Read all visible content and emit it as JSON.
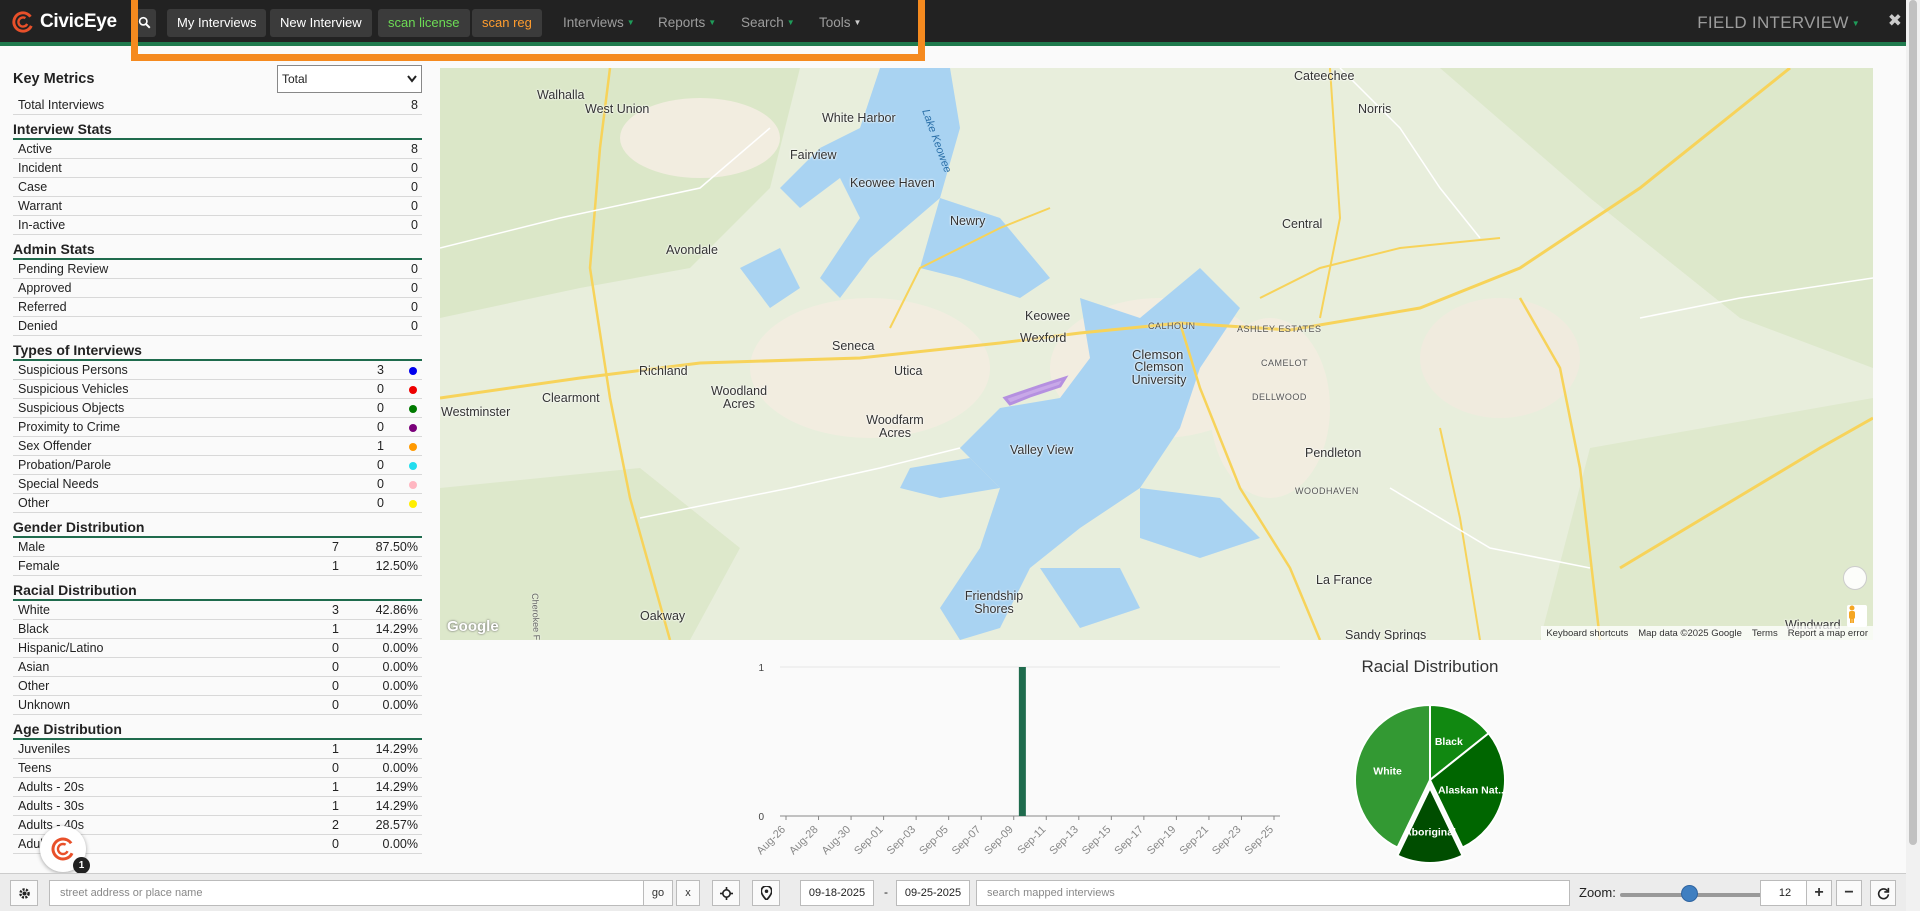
{
  "navbar": {
    "brand": "CivicEye",
    "my_interviews": "My Interviews",
    "new_interview": "New Interview",
    "scan_license": "scan license",
    "scan_reg": "scan reg",
    "menus": [
      "Interviews",
      "Reports",
      "Search",
      "Tools"
    ],
    "app_title": "FIELD INTERVIEW",
    "close": "✖"
  },
  "key_metrics": {
    "title": "Key Metrics",
    "select_value": "Total",
    "total_label": "Total Interviews",
    "total_value": "8"
  },
  "interview_stats": {
    "title": "Interview Stats",
    "rows": [
      {
        "label": "Active",
        "value": "8"
      },
      {
        "label": "Incident",
        "value": "0"
      },
      {
        "label": "Case",
        "value": "0"
      },
      {
        "label": "Warrant",
        "value": "0"
      },
      {
        "label": "In-active",
        "value": "0"
      }
    ]
  },
  "admin_stats": {
    "title": "Admin Stats",
    "rows": [
      {
        "label": "Pending Review",
        "value": "0"
      },
      {
        "label": "Approved",
        "value": "0"
      },
      {
        "label": "Referred",
        "value": "0"
      },
      {
        "label": "Denied",
        "value": "0"
      }
    ]
  },
  "types": {
    "title": "Types of Interviews",
    "rows": [
      {
        "label": "Suspicious Persons",
        "value": "3",
        "color": "#0000ee"
      },
      {
        "label": "Suspicious Vehicles",
        "value": "0",
        "color": "#ee0000"
      },
      {
        "label": "Suspicious Objects",
        "value": "0",
        "color": "#007a00"
      },
      {
        "label": "Proximity to Crime",
        "value": "0",
        "color": "#7a007a"
      },
      {
        "label": "Sex Offender",
        "value": "1",
        "color": "#ff9900"
      },
      {
        "label": "Probation/Parole",
        "value": "0",
        "color": "#22ddee"
      },
      {
        "label": "Special Needs",
        "value": "0",
        "color": "#ffb6c1"
      },
      {
        "label": "Other",
        "value": "0",
        "color": "#ffee00"
      }
    ]
  },
  "gender": {
    "title": "Gender Distribution",
    "rows": [
      {
        "label": "Male",
        "count": "7",
        "pct": "87.50%"
      },
      {
        "label": "Female",
        "count": "1",
        "pct": "12.50%"
      }
    ]
  },
  "racial": {
    "title": "Racial Distribution",
    "rows": [
      {
        "label": "White",
        "count": "3",
        "pct": "42.86%"
      },
      {
        "label": "Black",
        "count": "1",
        "pct": "14.29%"
      },
      {
        "label": "Hispanic/Latino",
        "count": "0",
        "pct": "0.00%"
      },
      {
        "label": "Asian",
        "count": "0",
        "pct": "0.00%"
      },
      {
        "label": "Other",
        "count": "0",
        "pct": "0.00%"
      },
      {
        "label": "Unknown",
        "count": "0",
        "pct": "0.00%"
      }
    ]
  },
  "age": {
    "title": "Age Distribution",
    "rows": [
      {
        "label": "Juveniles",
        "count": "1",
        "pct": "14.29%"
      },
      {
        "label": "Teens",
        "count": "0",
        "pct": "0.00%"
      },
      {
        "label": "Adults - 20s",
        "count": "1",
        "pct": "14.29%"
      },
      {
        "label": "Adults - 30s",
        "count": "1",
        "pct": "14.29%"
      },
      {
        "label": "Adults - 40s",
        "count": "2",
        "pct": "28.57%"
      },
      {
        "label": "Adults - 50s",
        "count": "0",
        "pct": "0.00%"
      }
    ]
  },
  "mini_badge": "1",
  "map": {
    "places": [
      "Walhalla",
      "West Union",
      "White Harbor",
      "Fairview",
      "Keowee Haven",
      "Newry",
      "Avondale",
      "Seneca",
      "Utica",
      "Keowee",
      "Wexford",
      "Richland",
      "Clearmont",
      "Woodland Acres",
      "Westminster",
      "Woodfarm Acres",
      "Valley View",
      "Clemson",
      "Clemson University",
      "Central",
      "Norris",
      "Cateechee",
      "Pendleton",
      "La France",
      "Friendship Shores",
      "Oakway",
      "Sandy Springs",
      "Windward"
    ],
    "small_places": [
      "CALHOUN",
      "ASHLEY ESTATES",
      "CAMELOT",
      "DELLWOOD",
      "WOODHAVEN"
    ],
    "water": [
      "Lake Keowee",
      "Cherokee Foothills Scenic"
    ],
    "google": "Google",
    "attribution": [
      "Keyboard shortcuts",
      "Map data ©2025 Google",
      "Terms",
      "Report a map error"
    ]
  },
  "chart_data": [
    {
      "type": "bar",
      "title": "",
      "categories": [
        "Aug-26",
        "Aug-28",
        "Aug-30",
        "Sep-01",
        "Sep-03",
        "Sep-05",
        "Sep-07",
        "Sep-09",
        "Sep-11",
        "Sep-13",
        "Sep-15",
        "Sep-17",
        "Sep-19",
        "Sep-21",
        "Sep-23",
        "Sep-25"
      ],
      "bars": [
        {
          "x": "Sep-09",
          "offset_days": 0.5,
          "value": 1
        }
      ],
      "ylim": [
        0,
        1
      ],
      "yticks": [
        "0",
        "1"
      ],
      "color": "#1f6b4d"
    },
    {
      "type": "pie",
      "title": "Racial Distribution",
      "slices": [
        {
          "label": "White",
          "value": 3,
          "color": "#339933"
        },
        {
          "label": "Black",
          "value": 1,
          "color": "#118811"
        },
        {
          "label": "Alaskan Nat...",
          "value": 2,
          "color": "#006600"
        },
        {
          "label": "Aboriginal",
          "value": 1,
          "color": "#004d00"
        }
      ]
    }
  ],
  "bottom": {
    "address_placeholder": "street address or place name",
    "go": "go",
    "x": "x",
    "date_from": "09-18-2025",
    "dash": "-",
    "date_to": "09-25-2025",
    "search_placeholder": "search mapped interviews",
    "zoom_label": "Zoom:",
    "zoom_value": "12"
  }
}
